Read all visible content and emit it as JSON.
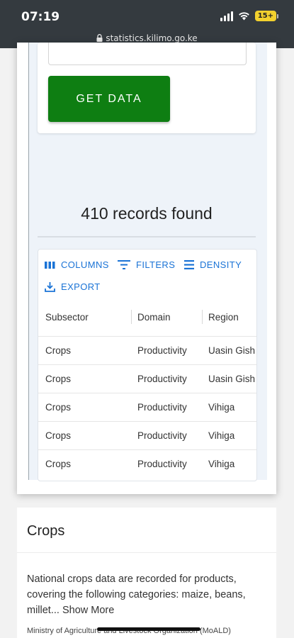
{
  "status_bar": {
    "time": "07:19",
    "battery": "15+",
    "url": "statistics.kilimo.go.ke"
  },
  "form": {
    "get_data_label": "GET DATA"
  },
  "results": {
    "count_text": "410 records found"
  },
  "grid": {
    "toolbar": {
      "columns": "COLUMNS",
      "filters": "FILTERS",
      "density": "DENSITY",
      "export": "EXPORT"
    },
    "headers": [
      "Subsector",
      "Domain",
      "Region"
    ],
    "rows": [
      [
        "Crops",
        "Productivity",
        "Uasin Gish"
      ],
      [
        "Crops",
        "Productivity",
        "Uasin Gish"
      ],
      [
        "Crops",
        "Productivity",
        "Vihiga"
      ],
      [
        "Crops",
        "Productivity",
        "Vihiga"
      ],
      [
        "Crops",
        "Productivity",
        "Vihiga"
      ]
    ]
  },
  "crops_card": {
    "title": "Crops",
    "description": "National crops data are recorded for products, covering the following categories: maize, beans, millet...",
    "show_more": "Show More",
    "source": "Ministry of Agriculture and Livestock Organization (MoALD)"
  },
  "colors": {
    "primary_button": "#0e7e12",
    "link_blue": "#1a73d6",
    "status_bar": "#343a3f"
  }
}
